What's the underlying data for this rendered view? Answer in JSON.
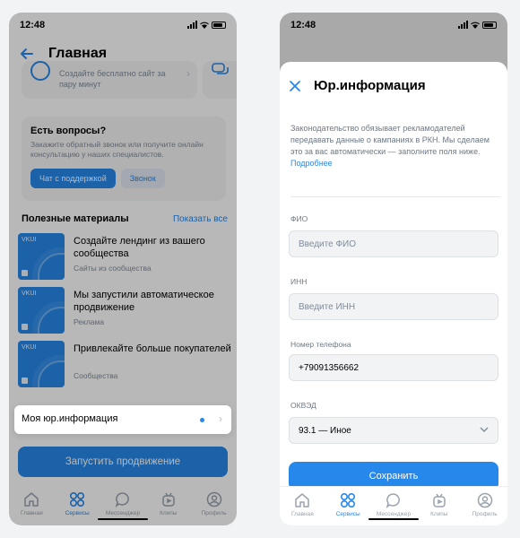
{
  "status": {
    "time": "12:48"
  },
  "home": {
    "title": "Главная",
    "promo_text": "Создайте бесплатно сайт за пару минут",
    "questions": {
      "title": "Есть вопросы?",
      "text": "Закажите обратный звонок или получите онлайн консультацию у наших специалистов.",
      "support_button": "Чат с поддержкой",
      "call_button": "Звонок"
    },
    "materials": {
      "title": "Полезные материалы",
      "show_all": "Показать все",
      "thumb_label": "VKUI",
      "items": [
        {
          "title": "Создайте лендинг из вашего сообщества",
          "subtitle": "Сайты из сообщества"
        },
        {
          "title": "Мы запустили автоматическое продвижение",
          "subtitle": "Реклама"
        },
        {
          "title": "Привлекайте больше покупателей",
          "subtitle": "Сообщества"
        }
      ]
    },
    "jur_item": "Моя юр.информация",
    "promote_button": "Запустить продвижение"
  },
  "sheet": {
    "title": "Юр.информация",
    "note": "Законодательство обязывает рекламодателей передавать данные о кампаниях в РКН. Мы сделаем это за вас автоматически — заполните поля ниже.",
    "more_link": "Подробнее",
    "fio": {
      "label": "ФИО",
      "placeholder": "Введите ФИО"
    },
    "inn": {
      "label": "ИНН",
      "placeholder": "Введите ИНН"
    },
    "phone": {
      "label": "Номер телефона",
      "value": "+79091356662"
    },
    "okved": {
      "label": "ОКВЭД",
      "value": "93.1 — Иное"
    },
    "save_button": "Сохранить"
  },
  "tabbar": {
    "items": [
      {
        "label": "Главная",
        "icon": "home-icon"
      },
      {
        "label": "Сервисы",
        "icon": "services-icon",
        "active": true
      },
      {
        "label": "Мессенджер",
        "icon": "messenger-icon"
      },
      {
        "label": "Клипы",
        "icon": "clips-icon"
      },
      {
        "label": "Профиль",
        "icon": "profile-icon"
      }
    ]
  },
  "colors": {
    "accent": "#2688eb",
    "overlay": "#00000047"
  }
}
